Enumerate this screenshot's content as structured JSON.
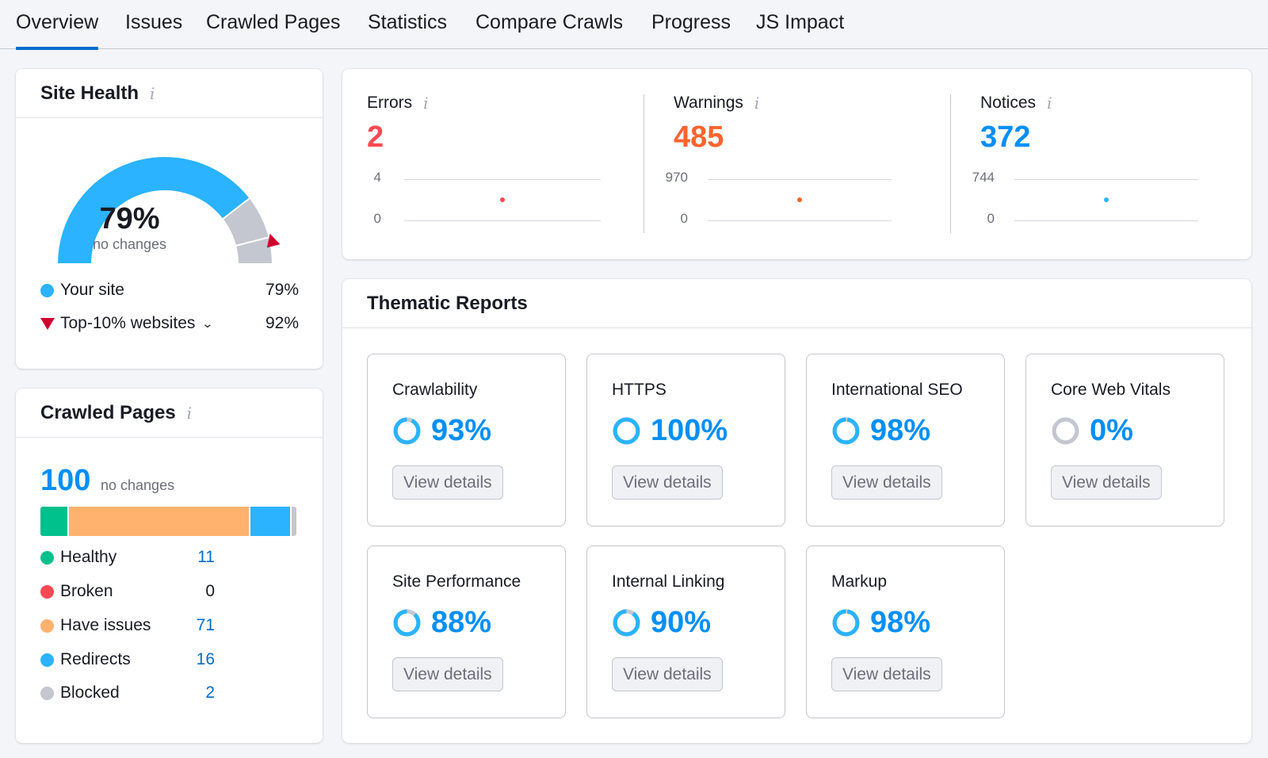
{
  "tabs": [
    {
      "label": "Overview",
      "active": true
    },
    {
      "label": "Issues"
    },
    {
      "label": "Crawled Pages"
    },
    {
      "label": "Statistics"
    },
    {
      "label": "Compare Crawls"
    },
    {
      "label": "Progress"
    },
    {
      "label": "JS Impact"
    }
  ],
  "site_health": {
    "title": "Site Health",
    "info_icon": "i",
    "value": "79%",
    "value_fraction": 0.79,
    "top10_fraction": 0.92,
    "change_text": "no changes",
    "legend": [
      {
        "label": "Your site",
        "value": "79%",
        "marker": "dot",
        "color": "#2bb3ff"
      },
      {
        "label": "Top-10% websites",
        "value": "92%",
        "marker": "triangle",
        "color": "#d1002f",
        "has_dropdown": true
      }
    ],
    "colors": {
      "fill": "#2bb3ff",
      "rest": "#c4c7cf",
      "marker": "#d1002f"
    }
  },
  "crawled_pages": {
    "title": "Crawled Pages",
    "info_icon": "i",
    "total": "100",
    "change_text": "no changes",
    "categories": [
      {
        "label": "Healthy",
        "value": "11",
        "count": 11,
        "color": "#00c08b"
      },
      {
        "label": "Broken",
        "value": "0",
        "count": 0,
        "color": "#ff4953"
      },
      {
        "label": "Have issues",
        "value": "71",
        "count": 71,
        "color": "#ffb26e"
      },
      {
        "label": "Redirects",
        "value": "16",
        "count": 16,
        "color": "#2bb3ff"
      },
      {
        "label": "Blocked",
        "value": "2",
        "count": 2,
        "color": "#c4c7cf"
      }
    ]
  },
  "issues": [
    {
      "label": "Errors",
      "info_icon": "i",
      "value": "2",
      "color": "#ff4953",
      "axis_max": "4",
      "axis_min": "0",
      "point": 2,
      "max": 4
    },
    {
      "label": "Warnings",
      "info_icon": "i",
      "value": "485",
      "color": "#ff642d",
      "axis_max": "970",
      "axis_min": "0",
      "point": 485,
      "max": 970
    },
    {
      "label": "Notices",
      "info_icon": "i",
      "value": "372",
      "color": "#008ff8",
      "axis_max": "744",
      "axis_min": "0",
      "point": 372,
      "max": 744
    }
  ],
  "thematic": {
    "title": "Thematic Reports",
    "button_label": "View details",
    "reports": [
      {
        "title": "Crawlability",
        "score": "93%",
        "fraction": 0.93
      },
      {
        "title": "HTTPS",
        "score": "100%",
        "fraction": 1.0
      },
      {
        "title": "International SEO",
        "score": "98%",
        "fraction": 0.98
      },
      {
        "title": "Core Web Vitals",
        "score": "0%",
        "fraction": 0.0
      },
      {
        "title": "Site Performance",
        "score": "88%",
        "fraction": 0.88
      },
      {
        "title": "Internal Linking",
        "score": "90%",
        "fraction": 0.9
      },
      {
        "title": "Markup",
        "score": "98%",
        "fraction": 0.98
      }
    ]
  }
}
